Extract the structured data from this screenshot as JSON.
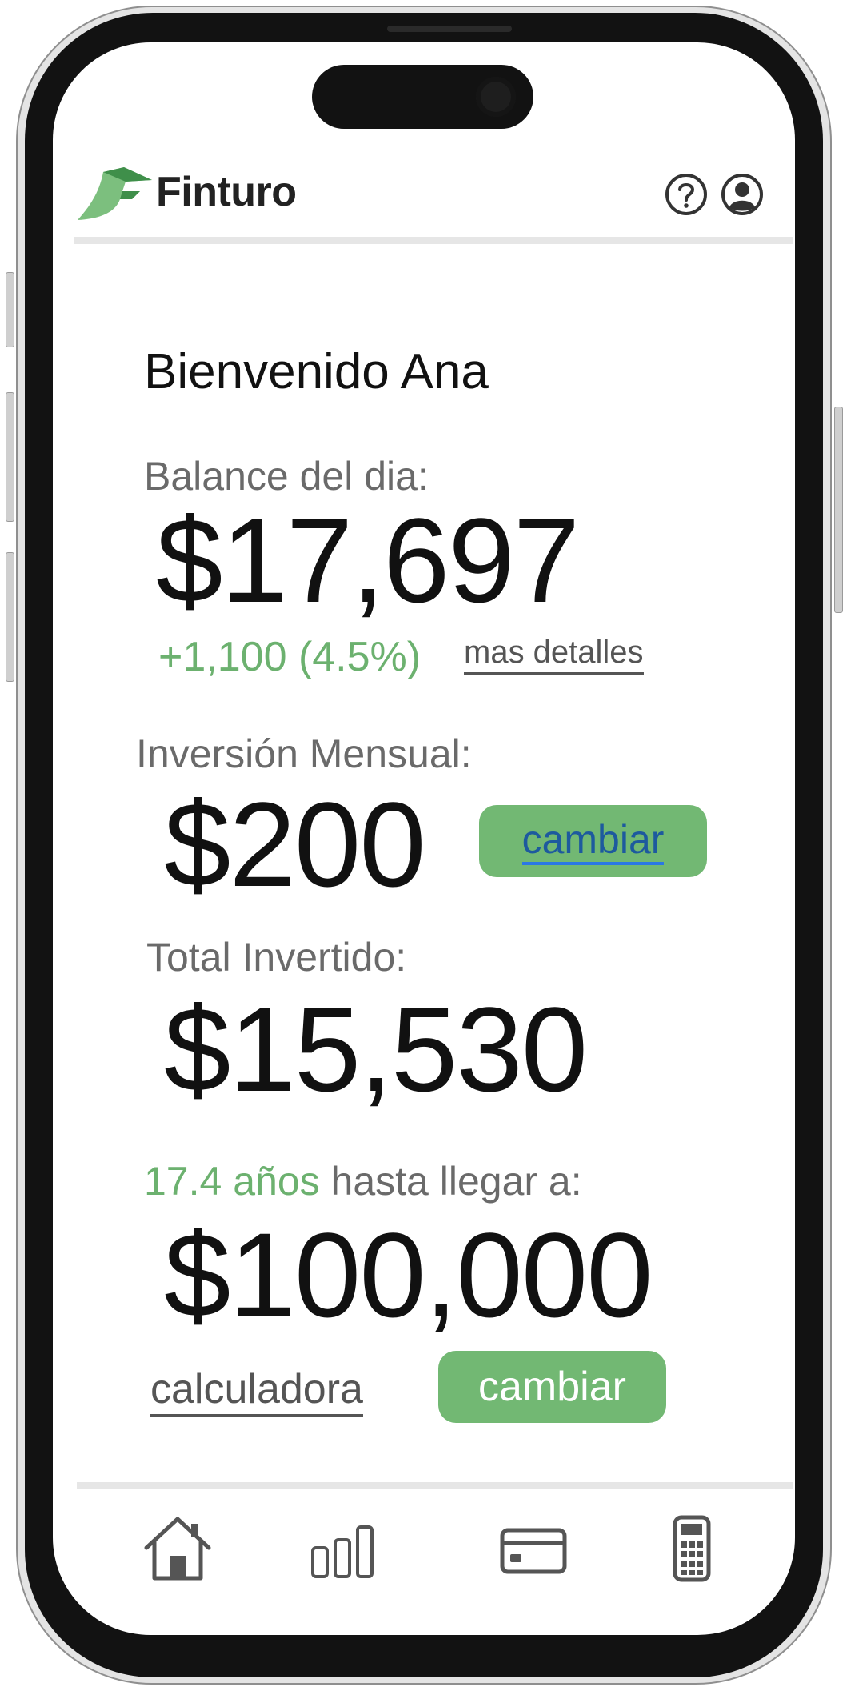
{
  "header": {
    "app_name": "Finturo",
    "icons": {
      "logo": "finturo-leaf-logo",
      "help": "help-circle-icon",
      "account": "user-circle-icon"
    }
  },
  "main": {
    "welcome": "Bienvenido Ana",
    "balance": {
      "label": "Balance del dia:",
      "amount": "$17,697",
      "change": "+1,100 (4.5%)",
      "details_link": "mas detalles"
    },
    "monthly_investment": {
      "label": "Inversión Mensual:",
      "amount": "$200",
      "change_button": "cambiar"
    },
    "total_invested": {
      "label": "Total Invertido:",
      "amount": "$15,530"
    },
    "goal": {
      "years": "17.4 años",
      "label_rest": " hasta llegar a:",
      "amount": "$100,000",
      "calculator_link": "calculadora",
      "change_button": "cambiar"
    }
  },
  "bottom_nav": {
    "items": [
      {
        "name": "home",
        "icon": "home-icon"
      },
      {
        "name": "stats",
        "icon": "bar-chart-icon"
      },
      {
        "name": "card",
        "icon": "credit-card-icon"
      },
      {
        "name": "calculator",
        "icon": "calculator-icon"
      }
    ]
  },
  "colors": {
    "accent_green": "#72b873",
    "positive_text": "#6cb16f",
    "link_blue": "#2b78e4",
    "frame": "#121212"
  }
}
